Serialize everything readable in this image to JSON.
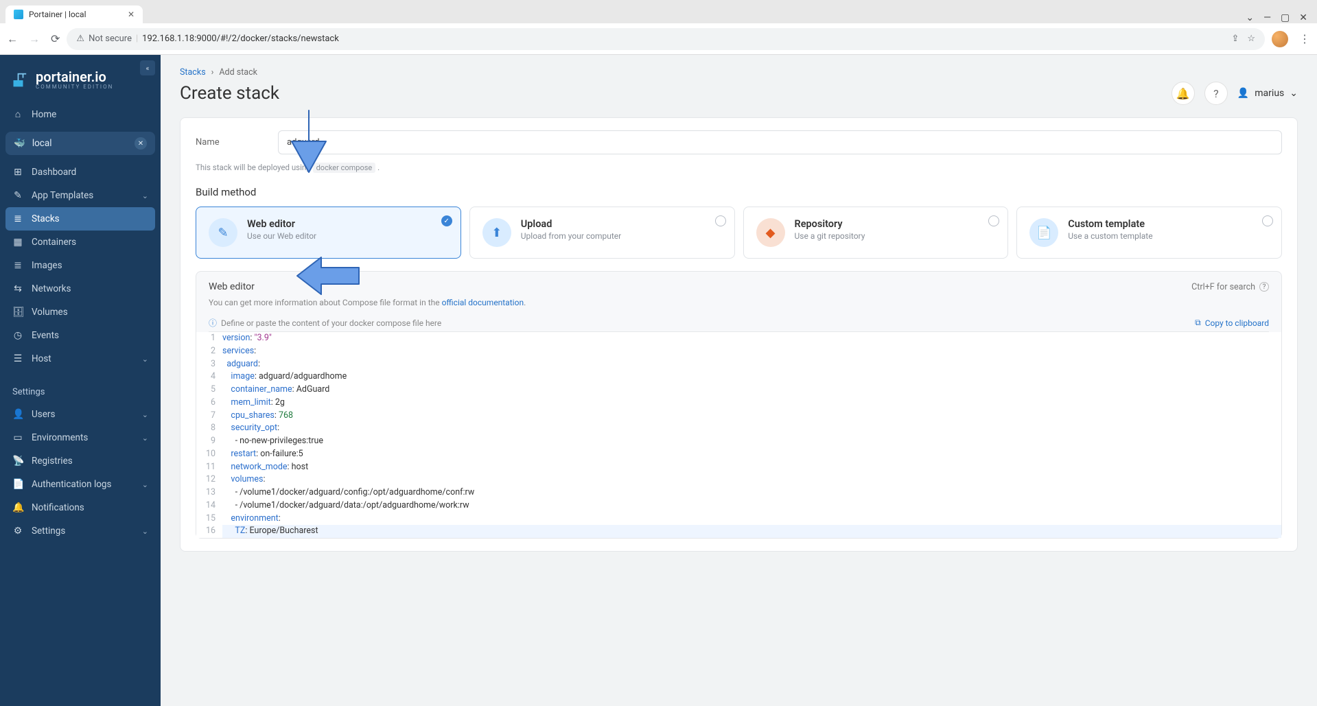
{
  "browser": {
    "tab_title": "Portainer | local",
    "not_secure": "Not secure",
    "url": "192.168.1.18:9000/#!/2/docker/stacks/newstack"
  },
  "brand": {
    "name": "portainer.io",
    "edition": "COMMUNITY EDITION"
  },
  "sidebar": {
    "home": "Home",
    "env": "local",
    "items": [
      {
        "label": "Dashboard",
        "glyph": "⊞"
      },
      {
        "label": "App Templates",
        "glyph": "✎",
        "expandable": true
      },
      {
        "label": "Stacks",
        "glyph": "≣",
        "active": true
      },
      {
        "label": "Containers",
        "glyph": "▦"
      },
      {
        "label": "Images",
        "glyph": "≣"
      },
      {
        "label": "Networks",
        "glyph": "⇆"
      },
      {
        "label": "Volumes",
        "glyph": "🗄"
      },
      {
        "label": "Events",
        "glyph": "◷"
      },
      {
        "label": "Host",
        "glyph": "☰",
        "expandable": true
      }
    ],
    "settings_label": "Settings",
    "settings": [
      {
        "label": "Users",
        "glyph": "👤",
        "expandable": true
      },
      {
        "label": "Environments",
        "glyph": "▭",
        "expandable": true
      },
      {
        "label": "Registries",
        "glyph": "📡"
      },
      {
        "label": "Authentication logs",
        "glyph": "📄",
        "expandable": true
      },
      {
        "label": "Notifications",
        "glyph": "🔔"
      },
      {
        "label": "Settings",
        "glyph": "⚙",
        "expandable": true
      }
    ]
  },
  "breadcrumbs": {
    "parent": "Stacks",
    "current": "Add stack"
  },
  "page_title": "Create stack",
  "user": "marius",
  "form": {
    "name_label": "Name",
    "name_value": "adguard",
    "helper_prefix": "This stack will be deployed using",
    "helper_code": "docker compose"
  },
  "build": {
    "heading": "Build method",
    "methods": [
      {
        "title": "Web editor",
        "sub": "Use our Web editor",
        "icon": "✎",
        "color": "blue",
        "selected": true
      },
      {
        "title": "Upload",
        "sub": "Upload from your computer",
        "icon": "⬆",
        "color": "blue"
      },
      {
        "title": "Repository",
        "sub": "Use a git repository",
        "icon": "◆",
        "color": "orange"
      },
      {
        "title": "Custom template",
        "sub": "Use a custom template",
        "icon": "📄",
        "color": "blue"
      }
    ]
  },
  "editor": {
    "title": "Web editor",
    "search_hint": "Ctrl+F for search",
    "help_text": "You can get more information about Compose file format in the ",
    "help_link": "official documentation",
    "placeholder_hint": "Define or paste the content of your docker compose file here",
    "copy_label": "Copy to clipboard",
    "code": [
      [
        [
          "key",
          "version"
        ],
        [
          "p",
          ": "
        ],
        [
          "str",
          "\"3.9\""
        ]
      ],
      [
        [
          "key",
          "services"
        ],
        [
          "p",
          ":"
        ]
      ],
      [
        [
          "p",
          "  "
        ],
        [
          "key",
          "adguard"
        ],
        [
          "p",
          ":"
        ]
      ],
      [
        [
          "p",
          "    "
        ],
        [
          "key",
          "image"
        ],
        [
          "p",
          ": adguard/adguardhome"
        ]
      ],
      [
        [
          "p",
          "    "
        ],
        [
          "key",
          "container_name"
        ],
        [
          "p",
          ": AdGuard"
        ]
      ],
      [
        [
          "p",
          "    "
        ],
        [
          "key",
          "mem_limit"
        ],
        [
          "p",
          ": 2g"
        ]
      ],
      [
        [
          "p",
          "    "
        ],
        [
          "key",
          "cpu_shares"
        ],
        [
          "p",
          ": "
        ],
        [
          "num",
          "768"
        ]
      ],
      [
        [
          "p",
          "    "
        ],
        [
          "key",
          "security_opt"
        ],
        [
          "p",
          ":"
        ]
      ],
      [
        [
          "p",
          "      - no-new-privileges:true"
        ]
      ],
      [
        [
          "p",
          "    "
        ],
        [
          "key",
          "restart"
        ],
        [
          "p",
          ": on-failure:5"
        ]
      ],
      [
        [
          "p",
          "    "
        ],
        [
          "key",
          "network_mode"
        ],
        [
          "p",
          ": host"
        ]
      ],
      [
        [
          "p",
          "    "
        ],
        [
          "key",
          "volumes"
        ],
        [
          "p",
          ":"
        ]
      ],
      [
        [
          "p",
          "      - /volume1/docker/adguard/config:/opt/adguardhome/conf:rw"
        ]
      ],
      [
        [
          "p",
          "      - /volume1/docker/adguard/data:/opt/adguardhome/work:rw"
        ]
      ],
      [
        [
          "p",
          "    "
        ],
        [
          "key",
          "environment"
        ],
        [
          "p",
          ":"
        ]
      ],
      [
        [
          "p",
          "      "
        ],
        [
          "key",
          "TZ"
        ],
        [
          "p",
          ": Europe/Bucharest"
        ]
      ]
    ]
  }
}
